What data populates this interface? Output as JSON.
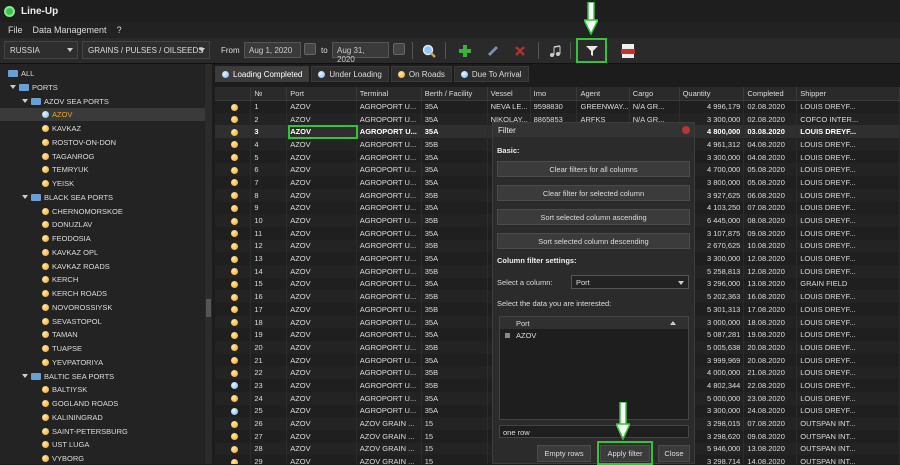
{
  "app": {
    "title": "Line-Up"
  },
  "menu": {
    "file": "File",
    "data_management": "Data Management",
    "help": "?"
  },
  "toolbar": {
    "country": "RUSSIA",
    "cargo_group": "GRAINS / PULSES / OILSEEDS",
    "from_label": "From",
    "from_date": "Aug 1, 2020",
    "to_label": "to",
    "to_date": "Aug 31, 2020"
  },
  "tree": [
    {
      "label": "ALL",
      "level": 0,
      "type": "folder"
    },
    {
      "label": "PORTS",
      "level": 1,
      "type": "folder"
    },
    {
      "label": "AZOV SEA PORTS",
      "level": 2,
      "type": "folder"
    },
    {
      "label": "AZOV",
      "level": 3,
      "type": "port",
      "selected": true
    },
    {
      "label": "KAVKAZ",
      "level": 3,
      "type": "port"
    },
    {
      "label": "ROSTOV-ON-DON",
      "level": 3,
      "type": "port"
    },
    {
      "label": "TAGANROG",
      "level": 3,
      "type": "port"
    },
    {
      "label": "TEMRYUK",
      "level": 3,
      "type": "port"
    },
    {
      "label": "YEISK",
      "level": 3,
      "type": "port"
    },
    {
      "label": "BLACK SEA PORTS",
      "level": 2,
      "type": "folder"
    },
    {
      "label": "CHERNOMORSKOE",
      "level": 3,
      "type": "port"
    },
    {
      "label": "DONUZLAV",
      "level": 3,
      "type": "port"
    },
    {
      "label": "FEODOSIA",
      "level": 3,
      "type": "port"
    },
    {
      "label": "KAVKAZ OPL",
      "level": 3,
      "type": "port"
    },
    {
      "label": "KAVKAZ ROADS",
      "level": 3,
      "type": "port"
    },
    {
      "label": "KERCH",
      "level": 3,
      "type": "port"
    },
    {
      "label": "KERCH ROADS",
      "level": 3,
      "type": "port"
    },
    {
      "label": "NOVOROSSIYSK",
      "level": 3,
      "type": "port"
    },
    {
      "label": "SEVASTOPOL",
      "level": 3,
      "type": "port"
    },
    {
      "label": "TAMAN",
      "level": 3,
      "type": "port"
    },
    {
      "label": "TUAPSE",
      "level": 3,
      "type": "port"
    },
    {
      "label": "YEVPATORIYA",
      "level": 3,
      "type": "port"
    },
    {
      "label": "BALTIC SEA PORTS",
      "level": 2,
      "type": "folder"
    },
    {
      "label": "BALTIYSK",
      "level": 3,
      "type": "port"
    },
    {
      "label": "GOGLAND ROADS",
      "level": 3,
      "type": "port"
    },
    {
      "label": "KALININGRAD",
      "level": 3,
      "type": "port"
    },
    {
      "label": "SAINT-PETERSBURG",
      "level": 3,
      "type": "port"
    },
    {
      "label": "UST LUGA",
      "level": 3,
      "type": "port"
    },
    {
      "label": "VYBORG",
      "level": 3,
      "type": "port"
    }
  ],
  "tabs": [
    {
      "label": "Loading Completed",
      "dot": "blue",
      "active": true
    },
    {
      "label": "Under Loading",
      "dot": "blue"
    },
    {
      "label": "On Roads",
      "dot": "orange"
    },
    {
      "label": "Due To Arrival",
      "dot": "blue"
    }
  ],
  "columns": [
    "",
    "№",
    "Port",
    "Terminal",
    "Berth / Facility",
    "Vessel",
    "Imo",
    "Agent",
    "Cargo",
    "Quantity",
    "Completed",
    "Shipper"
  ],
  "rows": [
    [
      "orange",
      "1",
      "AZOV",
      "AGROPORT U...",
      "35A",
      "NEVA LE...",
      "9598830",
      "GREENWAY...",
      "N/A GR...",
      "4 996,179",
      "02.08.2020",
      "LOUIS DREYF..."
    ],
    [
      "orange",
      "2",
      "AZOV",
      "AGROPORT U...",
      "35A",
      "NIKOLAY...",
      "8865853",
      "ARFKS",
      "N/A GR...",
      "3 300,000",
      "02.08.2020",
      "COFCO INTER..."
    ],
    [
      "orange",
      "3",
      "AZOV",
      "AGROPORT U...",
      "35A",
      "",
      "",
      "",
      "",
      "4 800,000",
      "03.08.2020",
      "LOUIS DREYF..."
    ],
    [
      "orange",
      "4",
      "AZOV",
      "AGROPORT U...",
      "35B",
      "",
      "",
      "",
      "",
      "4 961,312",
      "04.08.2020",
      "LOUIS DREYF..."
    ],
    [
      "orange",
      "5",
      "AZOV",
      "AGROPORT U...",
      "35A",
      "",
      "",
      "",
      "",
      "3 300,000",
      "04.08.2020",
      "LOUIS DREYF..."
    ],
    [
      "orange",
      "6",
      "AZOV",
      "AGROPORT U...",
      "35A",
      "",
      "",
      "",
      "",
      "4 700,000",
      "05.08.2020",
      "LOUIS DREYF..."
    ],
    [
      "orange",
      "7",
      "AZOV",
      "AGROPORT U...",
      "35A",
      "",
      "",
      "",
      "",
      "3 800,000",
      "05.08.2020",
      "LOUIS DREYF..."
    ],
    [
      "orange",
      "8",
      "AZOV",
      "AGROPORT U...",
      "35B",
      "",
      "",
      "",
      "",
      "3 927,625",
      "06.08.2020",
      "LOUIS DREYF..."
    ],
    [
      "orange",
      "9",
      "AZOV",
      "AGROPORT U...",
      "35A",
      "",
      "",
      "",
      "",
      "4 103,250",
      "07.08.2020",
      "LOUIS DREYF..."
    ],
    [
      "orange",
      "10",
      "AZOV",
      "AGROPORT U...",
      "35B",
      "",
      "",
      "",
      "",
      "6 445,000",
      "08.08.2020",
      "LOUIS DREYF..."
    ],
    [
      "orange",
      "11",
      "AZOV",
      "AGROPORT U...",
      "35A",
      "",
      "",
      "",
      "",
      "3 107,875",
      "09.08.2020",
      "LOUIS DREYF..."
    ],
    [
      "orange",
      "12",
      "AZOV",
      "AGROPORT U...",
      "35B",
      "",
      "",
      "",
      "",
      "2 670,625",
      "10.08.2020",
      "LOUIS DREYF..."
    ],
    [
      "orange",
      "13",
      "AZOV",
      "AGROPORT U...",
      "35A",
      "",
      "",
      "",
      "",
      "3 300,000",
      "12.08.2020",
      "LOUIS DREYF..."
    ],
    [
      "orange",
      "14",
      "AZOV",
      "AGROPORT U...",
      "35B",
      "",
      "",
      "",
      "",
      "5 258,813",
      "12.08.2020",
      "LOUIS DREYF..."
    ],
    [
      "orange",
      "15",
      "AZOV",
      "AGROPORT U...",
      "35A",
      "",
      "",
      "",
      "",
      "3 296,000",
      "13.08.2020",
      "GRAIN FIELD"
    ],
    [
      "orange",
      "16",
      "AZOV",
      "AGROPORT U...",
      "35B",
      "",
      "",
      "",
      "",
      "5 202,363",
      "16.08.2020",
      "LOUIS DREYF..."
    ],
    [
      "orange",
      "17",
      "AZOV",
      "AGROPORT U...",
      "35B",
      "",
      "",
      "",
      "",
      "5 301,313",
      "17.08.2020",
      "LOUIS DREYF..."
    ],
    [
      "orange",
      "18",
      "AZOV",
      "AGROPORT U...",
      "35A",
      "",
      "",
      "",
      "",
      "3 000,000",
      "18.08.2020",
      "LOUIS DREYF..."
    ],
    [
      "orange",
      "19",
      "AZOV",
      "AGROPORT U...",
      "35A",
      "",
      "",
      "",
      "",
      "5 087,281",
      "19.08.2020",
      "LOUIS DREYF..."
    ],
    [
      "orange",
      "20",
      "AZOV",
      "AGROPORT U...",
      "35B",
      "",
      "",
      "",
      "",
      "5 005,638",
      "20.08.2020",
      "LOUIS DREYF..."
    ],
    [
      "orange",
      "21",
      "AZOV",
      "AGROPORT U...",
      "35A",
      "",
      "",
      "",
      "",
      "3 999,969",
      "20.08.2020",
      "LOUIS DREYF..."
    ],
    [
      "orange",
      "22",
      "AZOV",
      "AGROPORT U...",
      "35B",
      "",
      "",
      "",
      "",
      "4 000,000",
      "21.08.2020",
      "LOUIS DREYF..."
    ],
    [
      "blue",
      "23",
      "AZOV",
      "AGROPORT U...",
      "35B",
      "",
      "",
      "",
      "",
      "4 802,344",
      "22.08.2020",
      "LOUIS DREYF..."
    ],
    [
      "orange",
      "24",
      "AZOV",
      "AGROPORT U...",
      "35A",
      "",
      "",
      "",
      "",
      "5 000,000",
      "23.08.2020",
      "LOUIS DREYF..."
    ],
    [
      "blue",
      "25",
      "AZOV",
      "AGROPORT U...",
      "35A",
      "",
      "",
      "",
      "",
      "3 300,000",
      "24.08.2020",
      "LOUIS DREYF..."
    ],
    [
      "orange",
      "26",
      "AZOV",
      "AZOV GRAIN ...",
      "15",
      "",
      "",
      "",
      "",
      "3 298,015",
      "07.08.2020",
      "OUTSPAN INT..."
    ],
    [
      "orange",
      "27",
      "AZOV",
      "AZOV GRAIN ...",
      "15",
      "",
      "",
      "",
      "",
      "3 298,620",
      "09.08.2020",
      "OUTSPAN INT..."
    ],
    [
      "orange",
      "28",
      "AZOV",
      "AZOV GRAIN ...",
      "15",
      "",
      "",
      "",
      "",
      "5 946,000",
      "13.08.2020",
      "OUTSPAN INT..."
    ],
    [
      "orange",
      "29",
      "AZOV",
      "AZOV GRAIN ...",
      "15",
      "",
      "",
      "",
      "",
      "3 298,714",
      "14.08.2020",
      "OUTSPAN INT..."
    ]
  ],
  "filter": {
    "title": "Filter",
    "basic_label": "Basic:",
    "clear_all": "Clear filters for all columns",
    "clear_selected": "Clear filter for selected column",
    "sort_asc": "Sort selected column ascending",
    "sort_desc": "Sort selected column descending",
    "settings_label": "Column filter settings:",
    "select_column_label": "Select a column:",
    "selected_column": "Port",
    "interest_label": "Select the data you are interested:",
    "list_header": "Port",
    "list_items": [
      "AZOV"
    ],
    "status": "one row",
    "empty_rows": "Empty rows",
    "apply": "Apply filter",
    "close": "Close"
  },
  "colors": {
    "accent_green": "#34c43a",
    "dot_orange": "#f3a21b",
    "dot_blue": "#7db4e8"
  }
}
